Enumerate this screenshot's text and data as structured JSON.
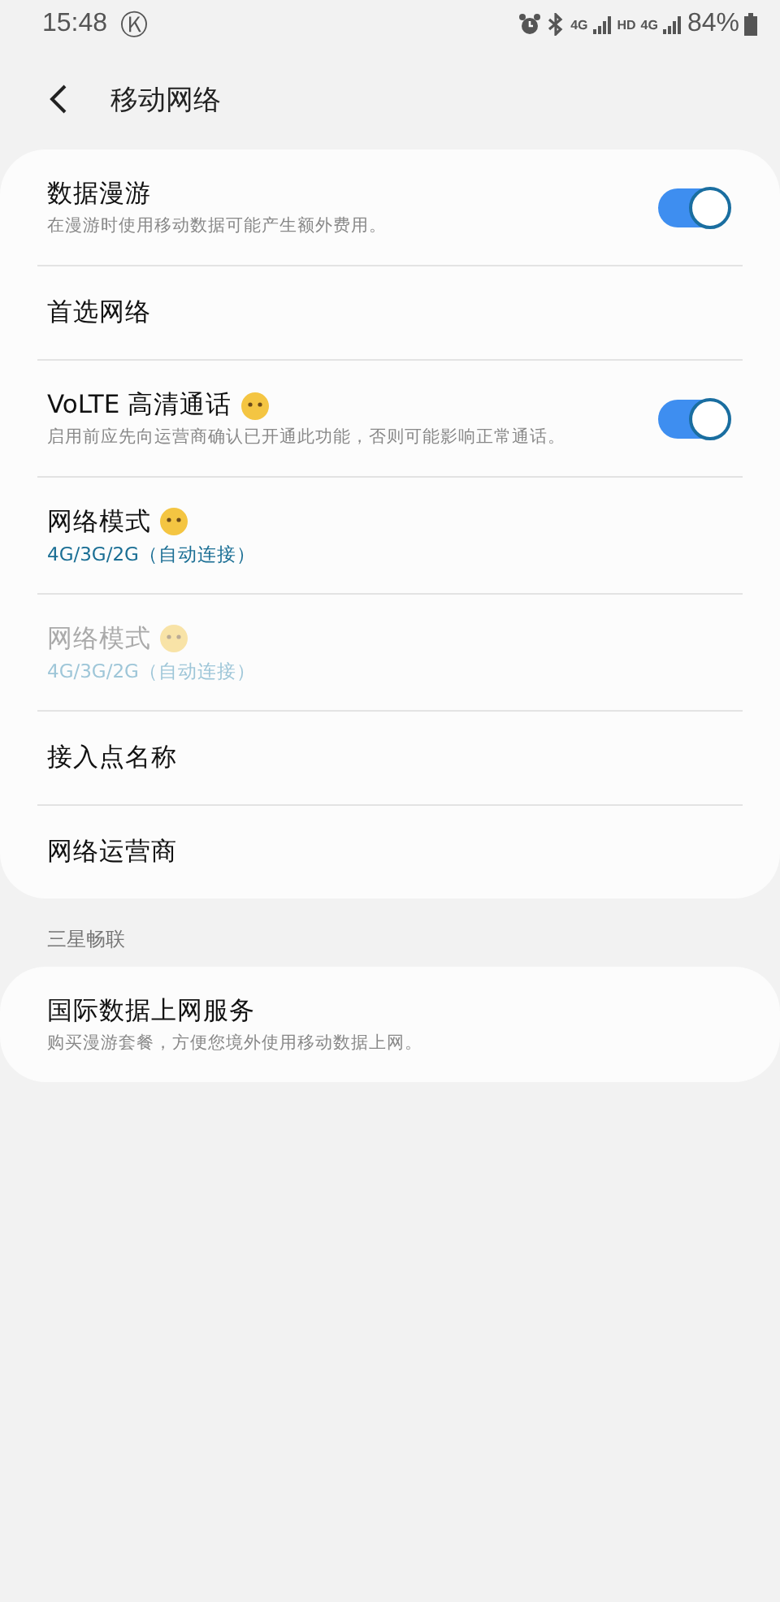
{
  "status_bar": {
    "time": "15:48",
    "notice_glyph": "Ⓚ",
    "network_1": "4G",
    "hd": "HD",
    "network_2": "4G",
    "battery": "84%"
  },
  "header": {
    "title": "移动网络"
  },
  "sections": [
    {
      "items": [
        {
          "kind": "toggle",
          "title": "数据漫游",
          "subtitle": "在漫游时使用移动数据可能产生额外费用。",
          "on": true,
          "emoji": false,
          "disabled": false
        },
        {
          "kind": "plain",
          "title": "首选网络",
          "emoji": false,
          "disabled": false
        },
        {
          "kind": "toggle",
          "title": "VoLTE 高清通话",
          "subtitle": "启用前应先向运营商确认已开通此功能，否则可能影响正常通话。",
          "on": true,
          "emoji": true,
          "disabled": false
        },
        {
          "kind": "value",
          "title": "网络模式",
          "subtitle": "4G/3G/2G（自动连接）",
          "emoji": true,
          "disabled": false
        },
        {
          "kind": "value",
          "title": "网络模式",
          "subtitle": "4G/3G/2G（自动连接）",
          "emoji": true,
          "disabled": true
        },
        {
          "kind": "plain",
          "title": "接入点名称",
          "emoji": false,
          "disabled": false
        },
        {
          "kind": "plain",
          "title": "网络运营商",
          "emoji": false,
          "disabled": false
        }
      ]
    },
    {
      "heading": "三星畅联",
      "items": [
        {
          "kind": "plain",
          "title": "国际数据上网服务",
          "subtitle": "购买漫游套餐，方便您境外使用移动数据上网。",
          "emoji": false,
          "disabled": false
        }
      ]
    }
  ]
}
